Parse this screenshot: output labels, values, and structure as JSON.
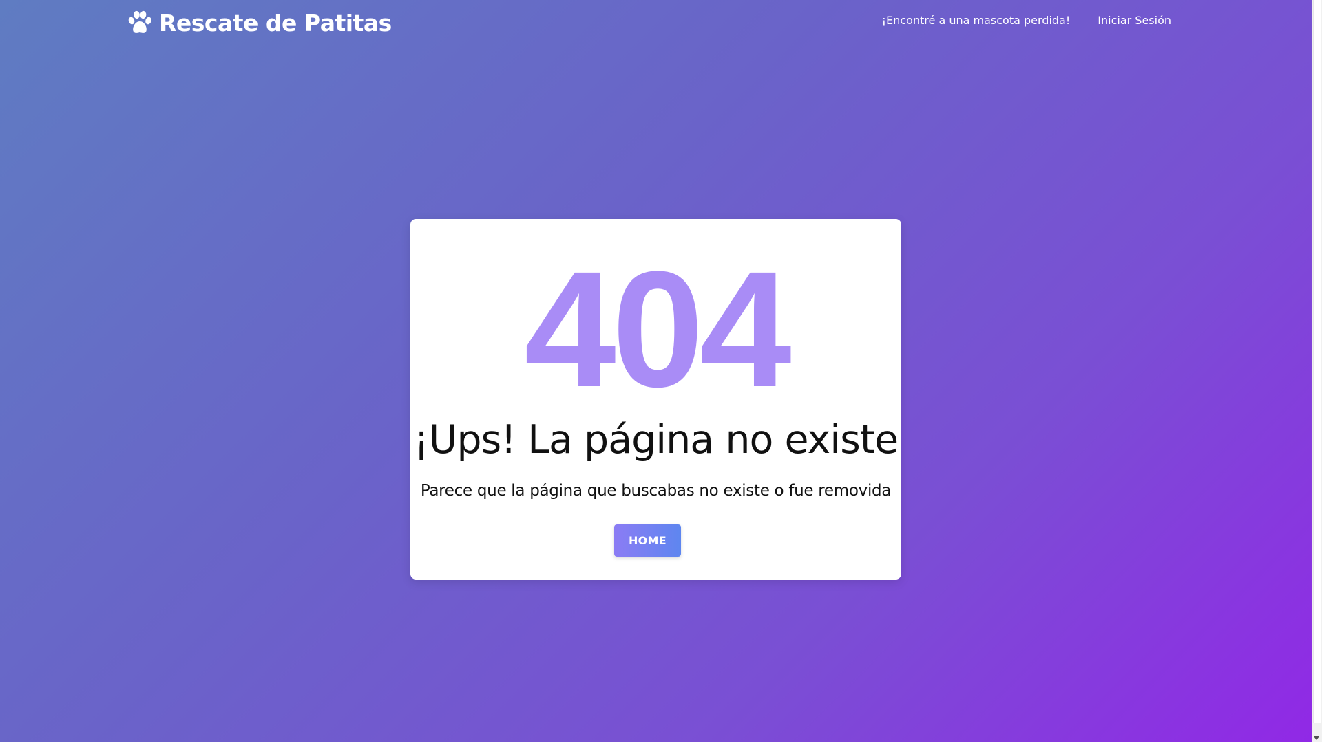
{
  "navbar": {
    "brand_icon": "paw-icon",
    "brand_name": "Rescate de Patitas",
    "links": [
      {
        "label": "¡Encontré a una mascota perdida!"
      },
      {
        "label": "Iniciar Sesión"
      }
    ]
  },
  "error_card": {
    "code": "404",
    "title": "¡Ups! La página no existe",
    "description": "Parece que la página que buscabas no existe o fue removida",
    "home_button": "HOME"
  },
  "colors": {
    "background_start": "#5f7cc2",
    "background_end": "#9128e6",
    "error_code": "#a98cf6",
    "button_start": "#8b7cf4",
    "button_end": "#5e86f0"
  }
}
